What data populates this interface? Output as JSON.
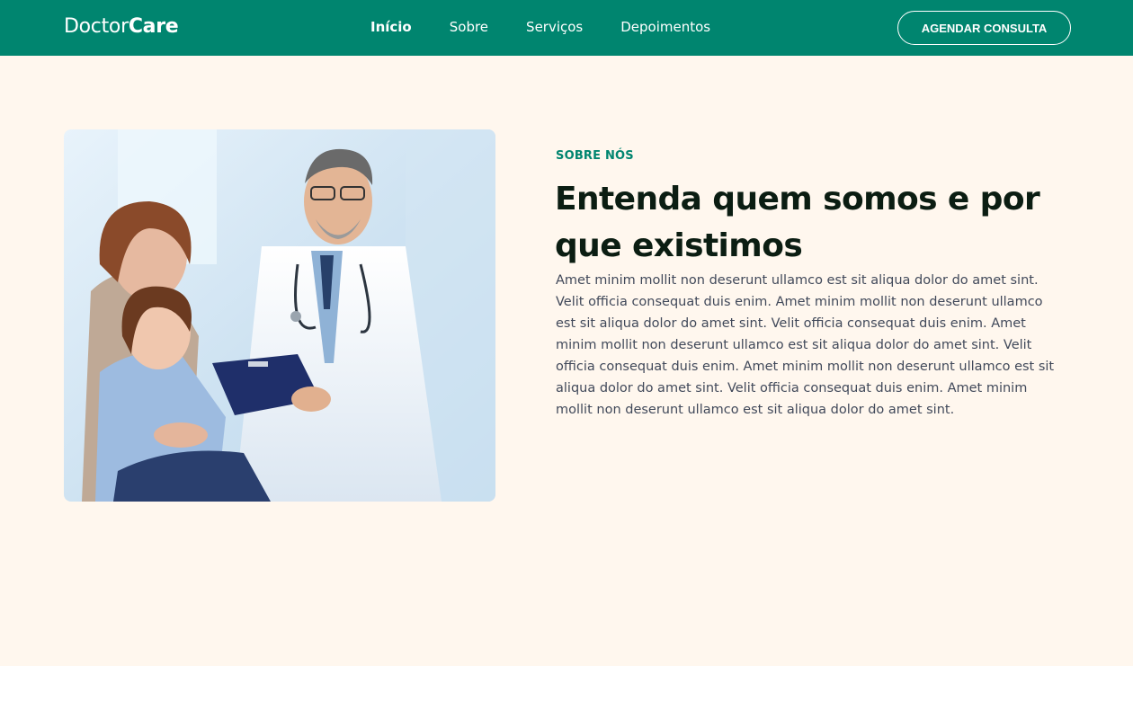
{
  "header": {
    "logo_regular": "Doctor",
    "logo_bold": "Care",
    "nav": [
      {
        "label": "Início"
      },
      {
        "label": "Sobre"
      },
      {
        "label": "Serviços"
      },
      {
        "label": "Depoimentos"
      }
    ],
    "cta_label": "AGENDAR CONSULTA"
  },
  "about": {
    "eyebrow": "SOBRE NÓS",
    "title": "Entenda quem somos e por que existimos",
    "body": "Amet minim mollit non deserunt ullamco est sit aliqua dolor do amet sint. Velit officia consequat duis enim. Amet minim mollit non deserunt ullamco est sit aliqua dolor do amet sint. Velit officia consequat duis enim. Amet minim mollit non deserunt ullamco est sit aliqua dolor do amet sint. Velit officia consequat duis enim. Amet minim mollit non deserunt ullamco est sit aliqua dolor do amet sint. Velit officia consequat duis enim. Amet minim mollit non deserunt ullamco est sit aliqua dolor do amet sint."
  },
  "colors": {
    "brand_green": "#00856f",
    "section_bg": "#fff7ee",
    "heading": "#0b1d12",
    "body_text": "#41495a"
  }
}
